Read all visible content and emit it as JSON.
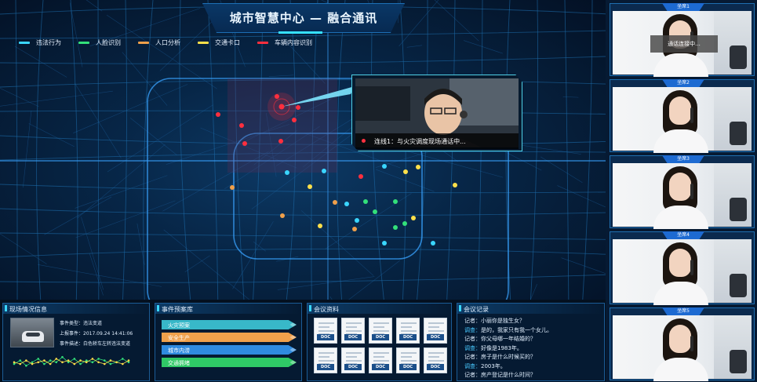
{
  "header": {
    "title": "城市智慧中心 — 融合通讯"
  },
  "colors": {
    "accent": "#36e0ff",
    "panel_border": "#1b5c96",
    "seat_tab": "#1d6ad1"
  },
  "legend": [
    {
      "label": "违法行为",
      "color": "#3ad6ff"
    },
    {
      "label": "人脸识别",
      "color": "#33e07a"
    },
    {
      "label": "人口分析",
      "color": "#f0a04b"
    },
    {
      "label": "交通卡口",
      "color": "#ffe04a"
    },
    {
      "label": "车辆内容识别",
      "color": "#ff2f3e"
    }
  ],
  "map_points": [
    {
      "category": "车辆内容识别"
    },
    {
      "category": "车辆内容识别"
    },
    {
      "category": "车辆内容识别"
    },
    {
      "category": "车辆内容识别"
    },
    {
      "category": "车辆内容识别"
    },
    {
      "category": "车辆内容识别"
    },
    {
      "category": "车辆内容识别"
    },
    {
      "category": "车辆内容识别"
    },
    {
      "category": "违法行为"
    },
    {
      "category": "违法行为"
    },
    {
      "category": "违法行为"
    },
    {
      "category": "违法行为"
    },
    {
      "category": "违法行为"
    },
    {
      "category": "违法行为"
    },
    {
      "category": "违法行为"
    },
    {
      "category": "交通卡口"
    },
    {
      "category": "交通卡口"
    },
    {
      "category": "交通卡口"
    },
    {
      "category": "交通卡口"
    },
    {
      "category": "交通卡口"
    },
    {
      "category": "交通卡口"
    },
    {
      "category": "人口分析"
    },
    {
      "category": "人口分析"
    },
    {
      "category": "人口分析"
    },
    {
      "category": "人口分析"
    },
    {
      "category": "人脸识别"
    },
    {
      "category": "人脸识别"
    },
    {
      "category": "人脸识别"
    },
    {
      "category": "人脸识别"
    },
    {
      "category": "人脸识别"
    }
  ],
  "popup": {
    "caption": "连线1：与火灾调度现场通话中..."
  },
  "scene_panel": {
    "title": "现场情况信息",
    "event_type": "事件类型：违法变道",
    "reported": "上报事件：2017.09.24  14:41:06",
    "description": "事件描述：白色轿车左转违法变道",
    "sparkline": {
      "series": [
        {
          "color": "#33e07a",
          "values": [
            5,
            7,
            4,
            6,
            8,
            5,
            7,
            6,
            9,
            6,
            8,
            5,
            7,
            6,
            8,
            7,
            5,
            6,
            8,
            6
          ]
        },
        {
          "color": "#ffe04a",
          "values": [
            6,
            5,
            7,
            5,
            6,
            7,
            5,
            8,
            6,
            7,
            5,
            7,
            6,
            8,
            6,
            5,
            7,
            6,
            5,
            7
          ]
        }
      ]
    }
  },
  "cases_panel": {
    "title": "事件预案库",
    "items": [
      {
        "label": "火灾预案",
        "color": "#38b8c9"
      },
      {
        "label": "安全生产",
        "color": "#f0a04b"
      },
      {
        "label": "城市内涝",
        "color": "#2f8be0"
      },
      {
        "label": "交通拥堵",
        "color": "#2fc966"
      }
    ]
  },
  "docs_panel": {
    "title": "会议资料",
    "docs": [
      "DOC",
      "DOC",
      "DOC",
      "DOC",
      "DOC",
      "DOC",
      "DOC",
      "DOC",
      "DOC",
      "DOC"
    ]
  },
  "records_panel": {
    "title": "会议记录",
    "lines": [
      {
        "who": "记者：",
        "text": "小丽你是独生女？",
        "alt": false
      },
      {
        "who": "调查：",
        "text": "是的，我家只有我一个女儿。",
        "alt": true
      },
      {
        "who": "记者：",
        "text": "你父母哪一年结婚的？",
        "alt": false
      },
      {
        "who": "调查：",
        "text": "好像是1983年。",
        "alt": true
      },
      {
        "who": "记者：",
        "text": "房子是什么时候买的？",
        "alt": false
      },
      {
        "who": "调查：",
        "text": "2003年。",
        "alt": true
      },
      {
        "who": "记者：",
        "text": "房产登记是什么时间？",
        "alt": false
      }
    ]
  },
  "seats": [
    {
      "label": "坐席1",
      "overlay": "通话连接中..."
    },
    {
      "label": "坐席2",
      "overlay": ""
    },
    {
      "label": "坐席3",
      "overlay": ""
    },
    {
      "label": "坐席4",
      "overlay": ""
    },
    {
      "label": "坐席5",
      "overlay": ""
    }
  ]
}
